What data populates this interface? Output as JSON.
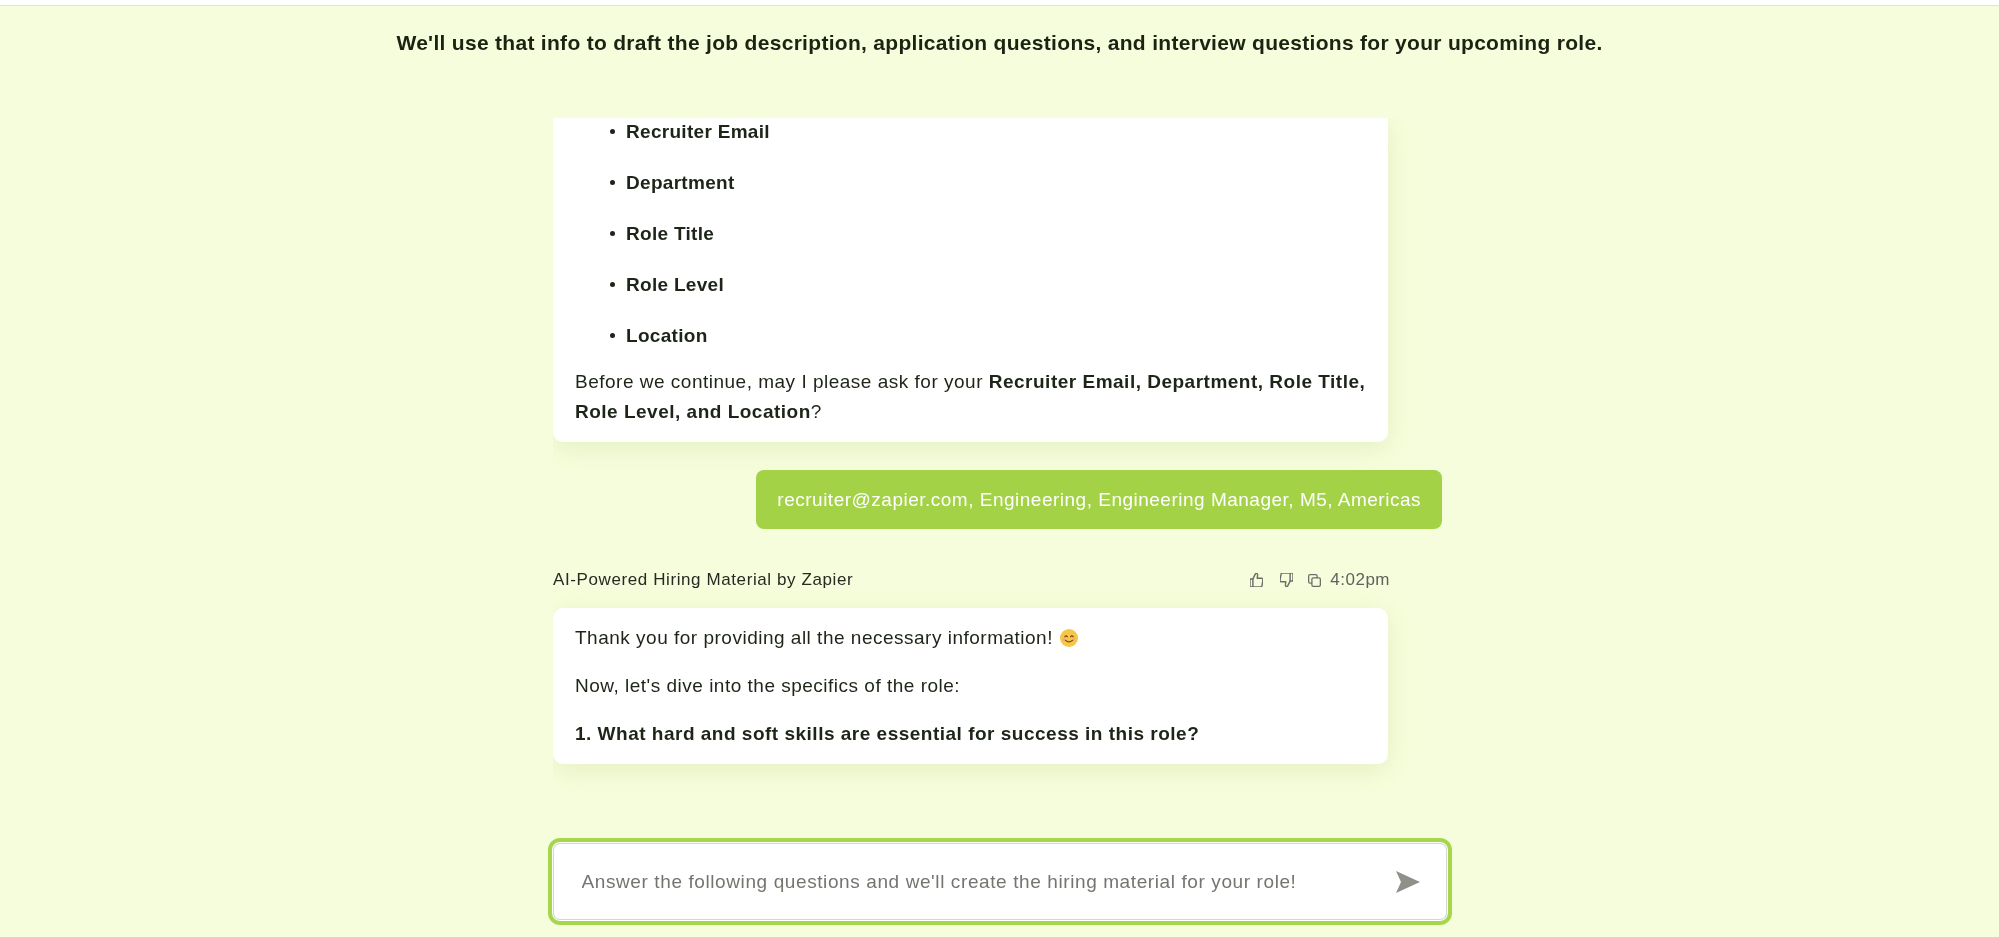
{
  "intro": {
    "text": "We'll use that info to draft the job description, application questions, and interview questions for your upcoming role."
  },
  "messages": [
    {
      "kind": "bot",
      "blocks": [
        {
          "kind": "bullets",
          "items": [
            "Recruiter Email",
            "Department",
            "Role Title",
            "Role Level",
            "Location"
          ]
        },
        {
          "kind": "paragraph",
          "bold": false,
          "text": "Before we continue, may I please ask for your **Recruiter Email, Department, Role Title, Role Level, and Location**?"
        }
      ]
    },
    {
      "kind": "user",
      "text": "recruiter@zapier.com, Engineering, Engineering Manager, M5, Americas"
    },
    {
      "kind": "bot",
      "sender": "AI-Powered Hiring Material by Zapier",
      "time": "4:02pm",
      "blocks": [
        {
          "kind": "paragraph",
          "bold": false,
          "emoji": true,
          "text": "Thank you for providing all the necessary information!"
        },
        {
          "kind": "paragraph",
          "bold": false,
          "text": "Now, let's dive into the specifics of the role:"
        },
        {
          "kind": "paragraph",
          "bold": true,
          "text": "1. What hard and soft skills are essential for success in this role?"
        }
      ]
    }
  ],
  "composer": {
    "placeholder": "Answer the following questions and we'll create the hiring material for your role!"
  }
}
